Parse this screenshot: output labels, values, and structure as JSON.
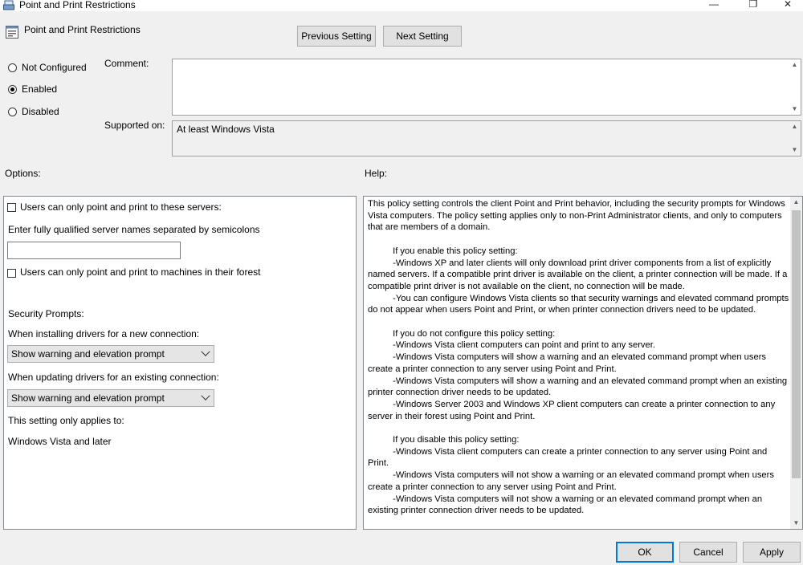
{
  "window": {
    "title": "Point and Print Restrictions",
    "controls": {
      "minimize": "—",
      "restore": "❐",
      "close": "✕"
    }
  },
  "header": {
    "policy_name": "Point and Print Restrictions",
    "prev_label": "Previous Setting",
    "next_label": "Next Setting"
  },
  "state": {
    "options": [
      {
        "label": "Not Configured",
        "selected": false
      },
      {
        "label": "Enabled",
        "selected": true
      },
      {
        "label": "Disabled",
        "selected": false
      }
    ]
  },
  "comment": {
    "label": "Comment:",
    "value": ""
  },
  "supported": {
    "label": "Supported on:",
    "value": "At least Windows Vista"
  },
  "options_panel": {
    "heading": "Options:",
    "servers_checkbox": "Users can only point and print to these servers:",
    "servers_prompt": "Enter fully qualified server names separated by semicolons",
    "servers_value": "",
    "forest_checkbox": "Users can only point and print to machines in their forest",
    "security_heading": "Security Prompts:",
    "new_conn_label": "When installing drivers for a new connection:",
    "new_conn_value": "Show warning and elevation prompt",
    "update_conn_label": "When updating drivers for an existing connection:",
    "update_conn_value": "Show warning and elevation prompt",
    "applies_label": "This setting only applies to:",
    "applies_value": "Windows Vista and later"
  },
  "help_panel": {
    "heading": "Help:",
    "text": "This policy setting controls the client Point and Print behavior, including the security prompts for Windows Vista computers. The policy setting applies only to non-Print Administrator clients, and only to computers that are members of a domain.\n\n          If you enable this policy setting:\n          -Windows XP and later clients will only download print driver components from a list of explicitly named servers. If a compatible print driver is available on the client, a printer connection will be made. If a compatible print driver is not available on the client, no connection will be made.\n          -You can configure Windows Vista clients so that security warnings and elevated command prompts do not appear when users Point and Print, or when printer connection drivers need to be updated.\n\n          If you do not configure this policy setting:\n          -Windows Vista client computers can point and print to any server.\n          -Windows Vista computers will show a warning and an elevated command prompt when users create a printer connection to any server using Point and Print.\n          -Windows Vista computers will show a warning and an elevated command prompt when an existing printer connection driver needs to be updated.\n          -Windows Server 2003 and Windows XP client computers can create a printer connection to any server in their forest using Point and Print.\n\n          If you disable this policy setting:\n          -Windows Vista client computers can create a printer connection to any server using Point and Print.\n          -Windows Vista computers will not show a warning or an elevated command prompt when users create a printer connection to any server using Point and Print.\n          -Windows Vista computers will not show a warning or an elevated command prompt when an existing printer connection driver needs to be updated."
  },
  "footer": {
    "ok_label": "OK",
    "cancel_label": "Cancel",
    "apply_label": "Apply"
  },
  "colors": {
    "accent": "#0078d7",
    "window_bg": "#f0f0f0"
  }
}
